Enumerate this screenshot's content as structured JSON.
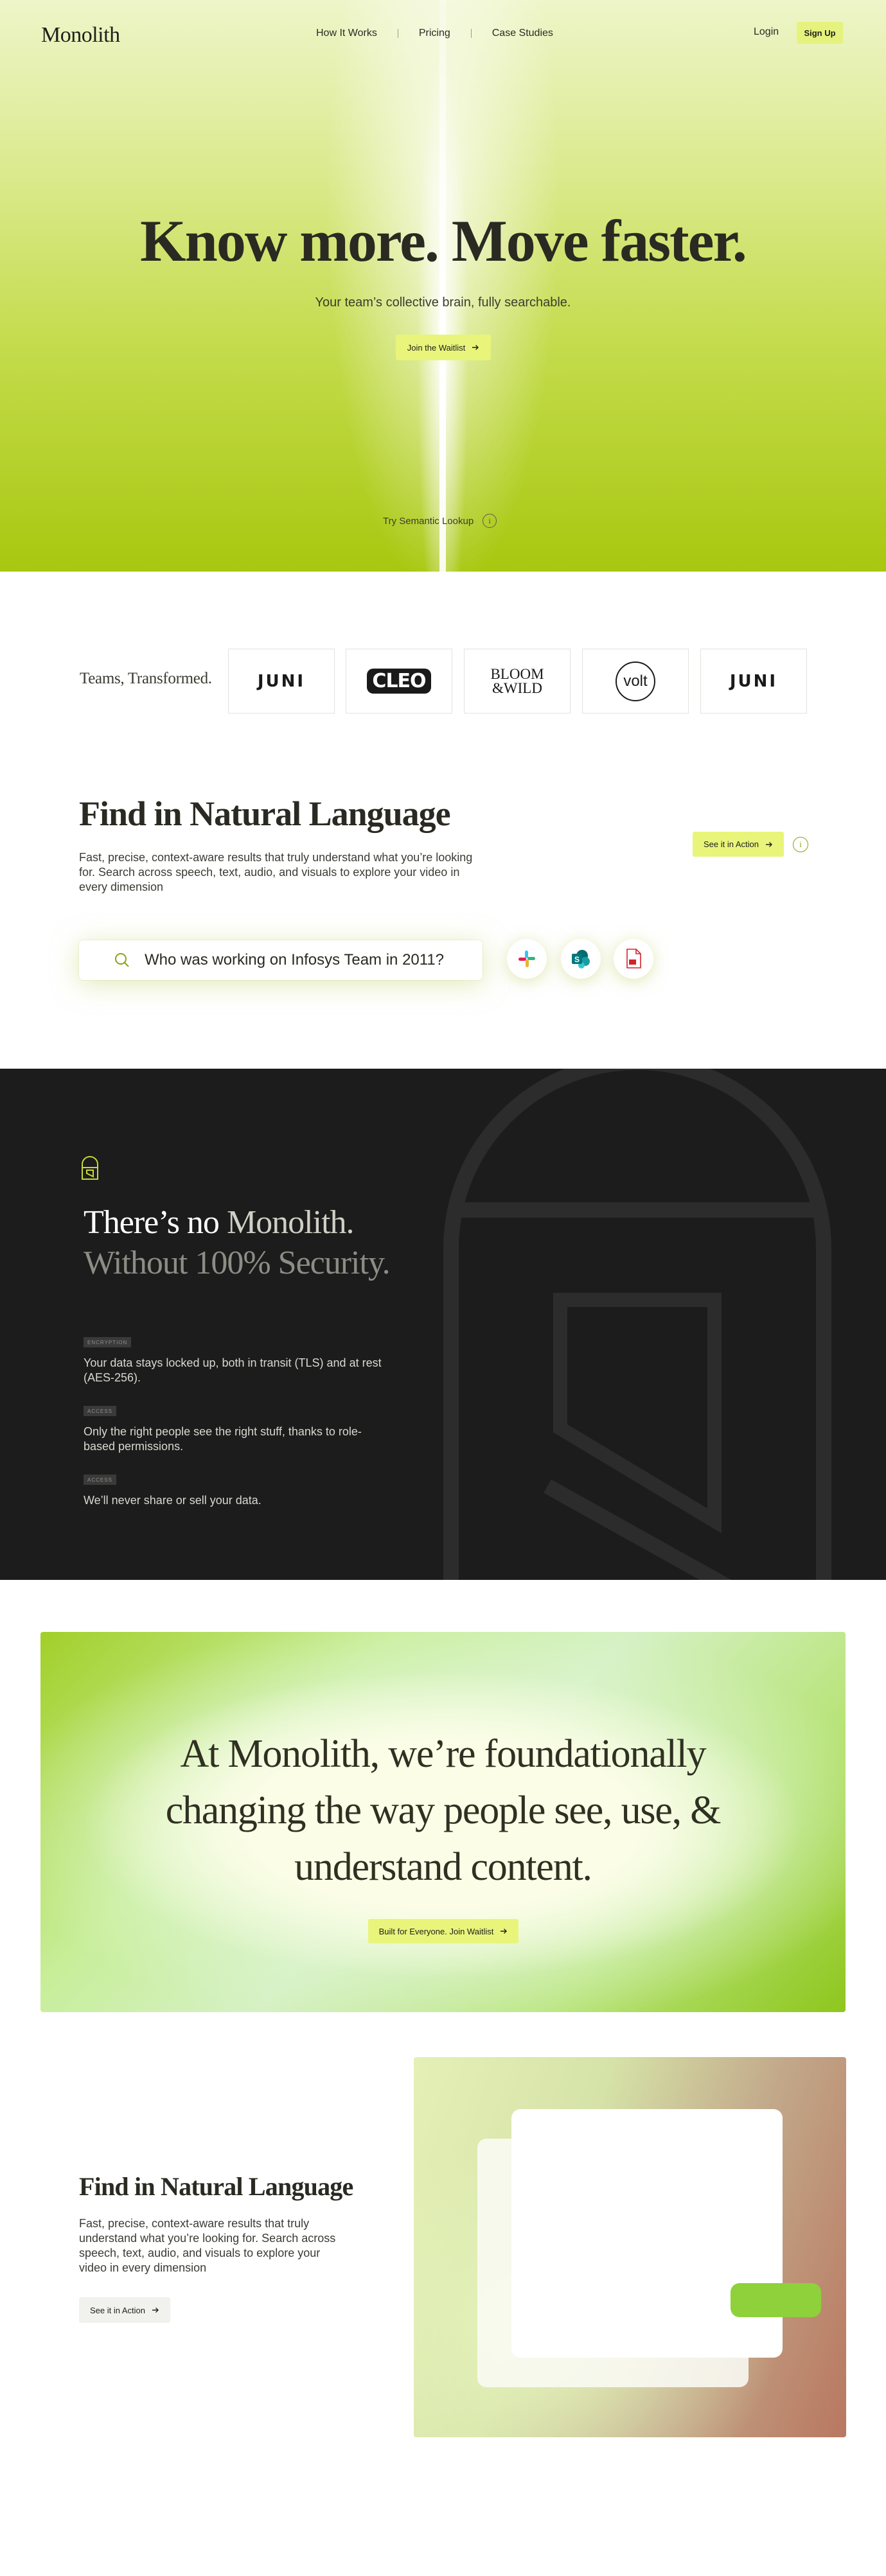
{
  "header": {
    "logo": "Monolith",
    "nav": [
      "How It Works",
      "Pricing",
      "Case Studies"
    ],
    "login": "Login",
    "signup": "Sign Up"
  },
  "hero": {
    "title": "Know more. Move faster.",
    "subtitle": "Your team’s collective brain, fully searchable.",
    "cta": "Join the Waitlist",
    "try_label": "Try Semantic Lookup",
    "info_glyph": "i"
  },
  "teams": {
    "label": "Teams, Transformed.",
    "logos": [
      {
        "name": "juni",
        "text": "JUNI"
      },
      {
        "name": "cleo",
        "text": "CLEO"
      },
      {
        "name": "bloom-and-wild",
        "line1": "BLOOM",
        "line2": "&WILD"
      },
      {
        "name": "volt",
        "text": "volt"
      },
      {
        "name": "juni",
        "text": "JUNI"
      }
    ]
  },
  "find": {
    "title": "Find in Natural Language",
    "description": "Fast, precise, context-aware results that truly understand what you’re looking for. Search across speech, text, audio, and visuals to explore your video in every dimension",
    "cta": "See it in Action",
    "search_query": "Who was working on Infosys Team in 2011?",
    "apps": [
      "slack-icon",
      "sharepoint-icon",
      "pdf-icon"
    ],
    "sharepoint_letter": "S",
    "accent": "#e8f57a"
  },
  "security": {
    "title_line1_a": "There’s no ",
    "title_line1_b": "Monolith.",
    "title_line2": "Without 100% Security.",
    "items": [
      {
        "tag": "ENCRYPTION",
        "text": "Your data stays locked up, both in transit (TLS) and at rest (AES-256)."
      },
      {
        "tag": "ACCESS",
        "text": "Only the right people see the right stuff, thanks to role-based permissions."
      },
      {
        "tag": "ACCESS",
        "text": "We’ll never share or sell your data."
      }
    ],
    "background": "#1c1c1c"
  },
  "statement": {
    "line1": "At Monolith, we’re foundationally",
    "line2": "changing the way people see, use, &",
    "line3": "understand content.",
    "cta": "Built for Everyone. Join Waitlist"
  },
  "feature": {
    "title": "Find in Natural Language",
    "description": "Fast, precise, context-aware results that truly understand what you’re looking for. Search across speech, text, audio, and visuals to explore your video in every dimension",
    "cta": "See it in Action"
  }
}
